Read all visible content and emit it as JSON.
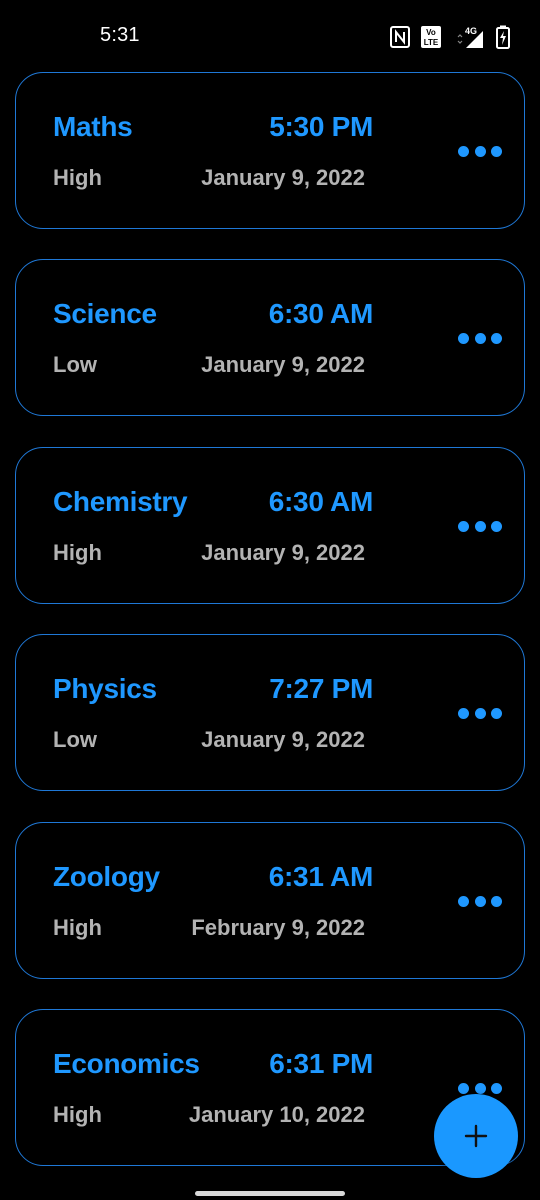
{
  "status_bar": {
    "time": "5:31",
    "icons": [
      "nfc-icon",
      "volte-icon",
      "signal-4g-icon",
      "battery-charging-icon"
    ]
  },
  "colors": {
    "accent": "#1f98ff",
    "card_border": "#1f78d6",
    "secondary_text": "#b3b3b3",
    "background": "#000000"
  },
  "tasks": [
    {
      "subject": "Maths",
      "time": "5:30 PM",
      "priority": "High",
      "date": "January 9, 2022"
    },
    {
      "subject": "Science",
      "time": "6:30 AM",
      "priority": "Low",
      "date": "January 9, 2022"
    },
    {
      "subject": "Chemistry",
      "time": "6:30 AM",
      "priority": "High",
      "date": "January 9, 2022"
    },
    {
      "subject": "Physics",
      "time": "7:27 PM",
      "priority": "Low",
      "date": "January 9, 2022"
    },
    {
      "subject": "Zoology",
      "time": "6:31 AM",
      "priority": "High",
      "date": "February 9, 2022"
    },
    {
      "subject": "Economics",
      "time": "6:31 PM",
      "priority": "High",
      "date": "January 10, 2022"
    }
  ],
  "fab": {
    "icon": "plus-icon"
  }
}
